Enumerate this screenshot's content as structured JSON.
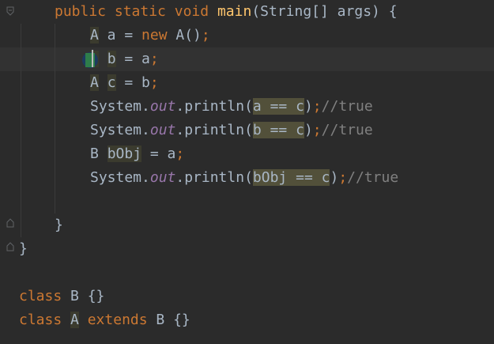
{
  "code_lines": {
    "l1": {
      "kw1": "public",
      "kw2": "static",
      "kw3": "void",
      "method": "main",
      "rest": "(String[] args) {"
    },
    "l2": {
      "type": "A",
      "mid": " a = ",
      "kw": "new",
      "ctor": " A()",
      "semi": ";"
    },
    "l3": {
      "type": "A",
      "ident": "b",
      "mid": " = a",
      "semi": ";"
    },
    "l4": {
      "type": "A",
      "ident": "c",
      "mid": " = b",
      "semi": ";"
    },
    "l5": {
      "pre": "System.",
      "field": "out",
      "call": ".println(",
      "expr": "a == c",
      "close": ")",
      "semi": ";",
      "comment": "//true"
    },
    "l6": {
      "pre": "System.",
      "field": "out",
      "call": ".println(",
      "expr": "b == c",
      "close": ")",
      "semi": ";",
      "comment": "//true"
    },
    "l7": {
      "type": "B",
      "ident": "bObj",
      "mid": " = a",
      "semi": ";"
    },
    "l8": {
      "pre": "System.",
      "field": "out",
      "call": ".println(",
      "expr": "bObj == c",
      "close": ")",
      "semi": ";",
      "comment": "//true"
    },
    "l9": {
      "text": "}"
    },
    "l10": {
      "text": "}"
    },
    "l11": {
      "kw": "class",
      "rest": " B {}"
    },
    "l12": {
      "kw": "class",
      "name": "A",
      "kw2": "extends",
      "rest": " B {}"
    }
  },
  "colors": {
    "background": "#2b2b2b",
    "keyword": "#cc7832",
    "method": "#ffc66d",
    "static_field": "#9876aa",
    "comment": "#808080",
    "text": "#a9b7c6",
    "usage_highlight": "#52503a"
  }
}
